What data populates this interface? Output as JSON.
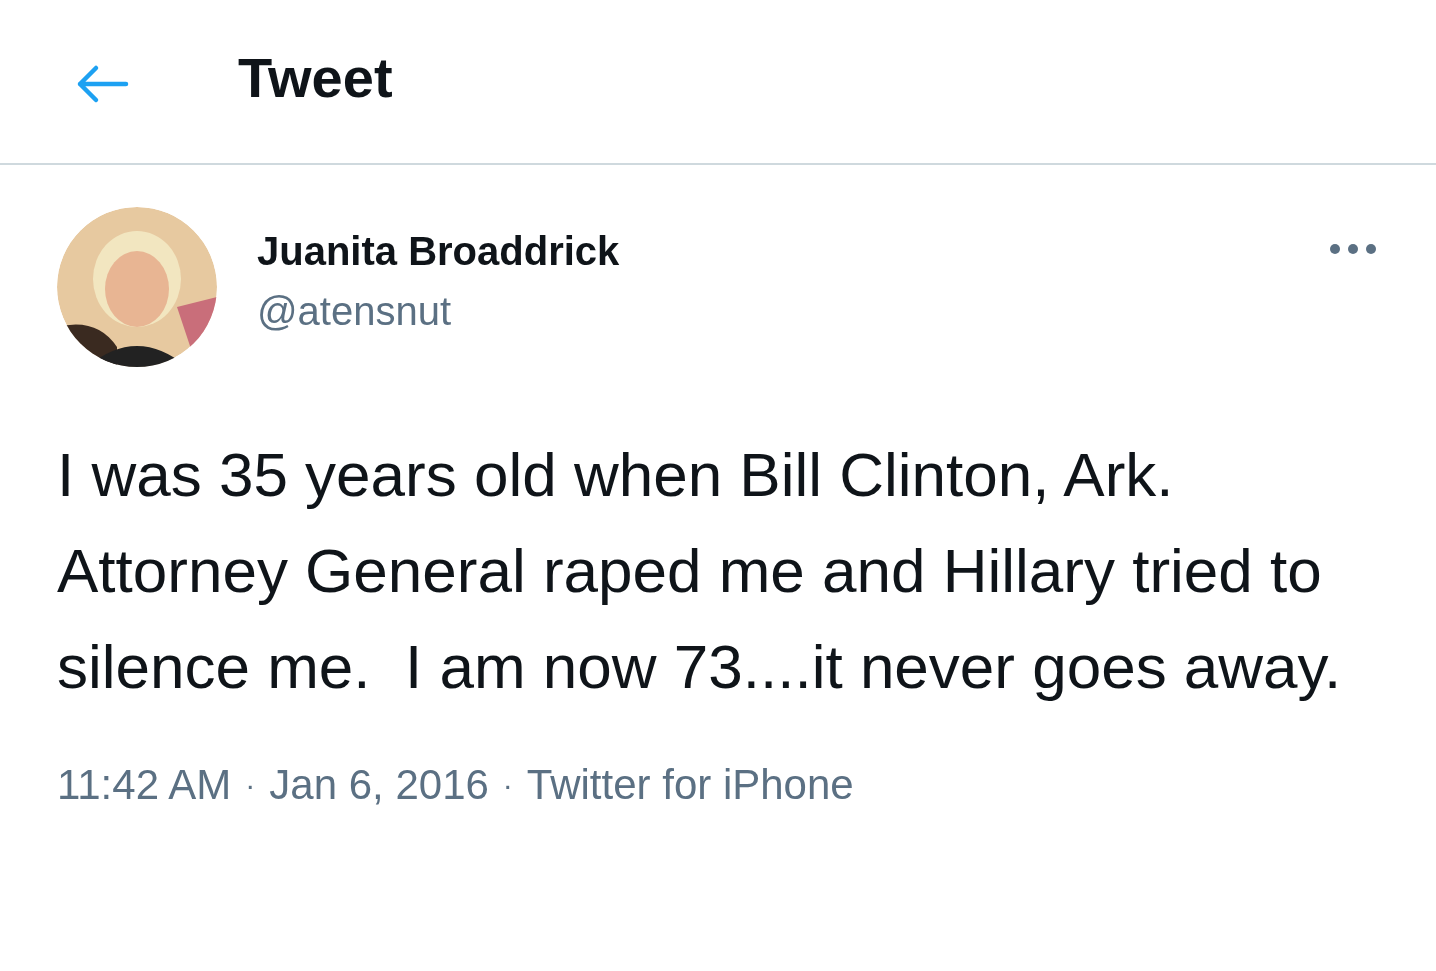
{
  "header": {
    "title": "Tweet"
  },
  "tweet": {
    "name": "Juanita Broaddrick",
    "handle": "@atensnut",
    "text": "I was 35 years old when Bill Clinton, Ark. Attorney General raped me and Hillary tried to silence me.  I am now 73....it never goes away.",
    "meta": [
      {
        "text": "11:42 AM",
        "kind": "time"
      },
      {
        "text": "·",
        "kind": "separator"
      },
      {
        "text": "Jan 6, 2016",
        "kind": "date"
      },
      {
        "text": "·",
        "kind": "separator"
      },
      {
        "text": "Twitter for iPhone",
        "kind": "source"
      }
    ]
  }
}
